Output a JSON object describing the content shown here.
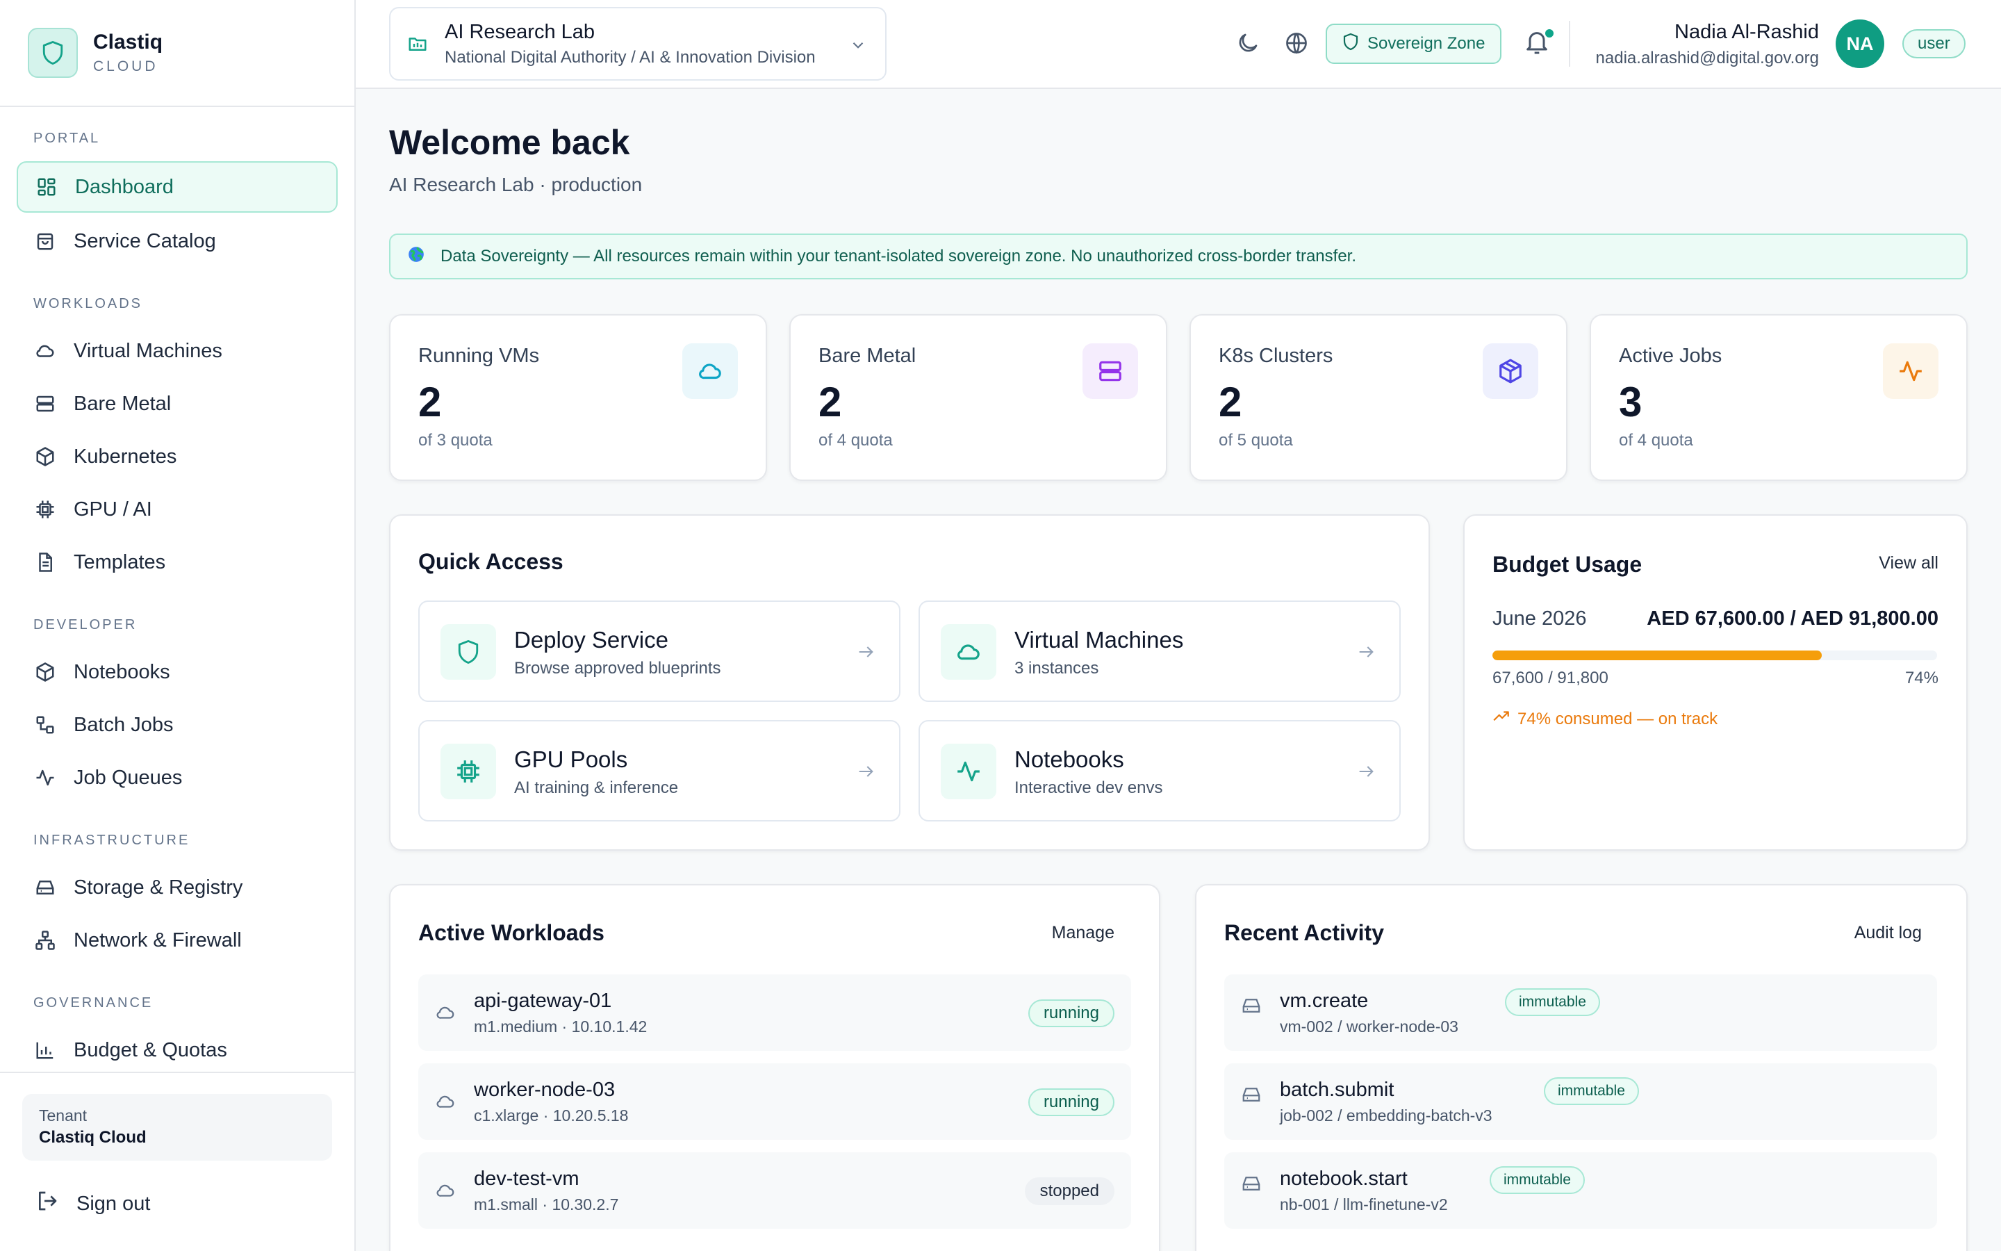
{
  "brand": {
    "name": "Clastiq",
    "sub": "CLOUD"
  },
  "sidebar": {
    "sections": {
      "portal": "PORTAL",
      "workloads": "WORKLOADS",
      "developer": "DEVELOPER",
      "infrastructure": "INFRASTRUCTURE",
      "governance": "GOVERNANCE"
    },
    "items": {
      "dashboard": "Dashboard",
      "catalog": "Service Catalog",
      "vms": "Virtual Machines",
      "baremetal": "Bare Metal",
      "kubernetes": "Kubernetes",
      "gpu": "GPU / AI",
      "templates": "Templates",
      "notebooks": "Notebooks",
      "batch": "Batch Jobs",
      "queues": "Job Queues",
      "storage": "Storage & Registry",
      "network": "Network & Firewall",
      "budget": "Budget & Quotas"
    },
    "tenant_label": "Tenant",
    "tenant_value": "Clastiq Cloud",
    "signout": "Sign out"
  },
  "topbar": {
    "project_title": "AI Research Lab",
    "project_sub": "National Digital Authority / AI & Innovation Division",
    "zone": "Sovereign Zone",
    "user_name": "Nadia Al-Rashid",
    "user_email": "nadia.alrashid@digital.gov.org",
    "avatar": "NA",
    "role": "user"
  },
  "page": {
    "title": "Welcome back",
    "subtitle": "AI Research Lab · production",
    "banner": "Data Sovereignty — All resources remain within your tenant-isolated sovereign zone. No unauthorized cross-border transfer."
  },
  "stats": [
    {
      "label": "Running VMs",
      "value": "2",
      "quota": "of 3 quota",
      "icon": "cloud-icon",
      "color": "#0ea5c6"
    },
    {
      "label": "Bare Metal",
      "value": "2",
      "quota": "of 4 quota",
      "icon": "server-icon",
      "color": "#9333ea"
    },
    {
      "label": "K8s Clusters",
      "value": "2",
      "quota": "of 5 quota",
      "icon": "cube-icon",
      "color": "#4f46e5"
    },
    {
      "label": "Active Jobs",
      "value": "3",
      "quota": "of 4 quota",
      "icon": "activity-icon",
      "color": "#ea7a0c"
    }
  ],
  "quick_access": {
    "title": "Quick Access",
    "tiles": [
      {
        "title": "Deploy Service",
        "sub": "Browse approved blueprints",
        "icon": "shield-icon"
      },
      {
        "title": "Virtual Machines",
        "sub": "3 instances",
        "icon": "cloud-icon"
      },
      {
        "title": "GPU Pools",
        "sub": "AI training & inference",
        "icon": "chip-icon"
      },
      {
        "title": "Notebooks",
        "sub": "Interactive dev envs",
        "icon": "activity-icon"
      }
    ]
  },
  "budget": {
    "title": "Budget Usage",
    "link": "View all",
    "month": "June 2026",
    "amount": "AED 67,600.00 / AED 91,800.00",
    "used_text": "67,600 / 91,800",
    "percent_text": "74%",
    "fraction": 0.74,
    "note": "74% consumed — on track",
    "bar_color": "#f59e0b"
  },
  "workloads": {
    "title": "Active Workloads",
    "link": "Manage",
    "rows": [
      {
        "name": "api-gateway-01",
        "meta": "m1.medium · 10.10.1.42",
        "status": "running"
      },
      {
        "name": "worker-node-03",
        "meta": "c1.xlarge · 10.20.5.18",
        "status": "running"
      },
      {
        "name": "dev-test-vm",
        "meta": "m1.small · 10.30.2.7",
        "status": "stopped"
      }
    ]
  },
  "activity": {
    "title": "Recent Activity",
    "link": "Audit log",
    "rows": [
      {
        "name": "vm.create",
        "meta": "vm-002 / worker-node-03",
        "badge": "immutable"
      },
      {
        "name": "batch.submit",
        "meta": "job-002 / embedding-batch-v3",
        "badge": "immutable"
      },
      {
        "name": "notebook.start",
        "meta": "nb-001 / llm-finetune-v2",
        "badge": "immutable"
      }
    ]
  },
  "colors": {
    "accent": "#0f9d82",
    "accent_light": "#ecfbf6"
  }
}
